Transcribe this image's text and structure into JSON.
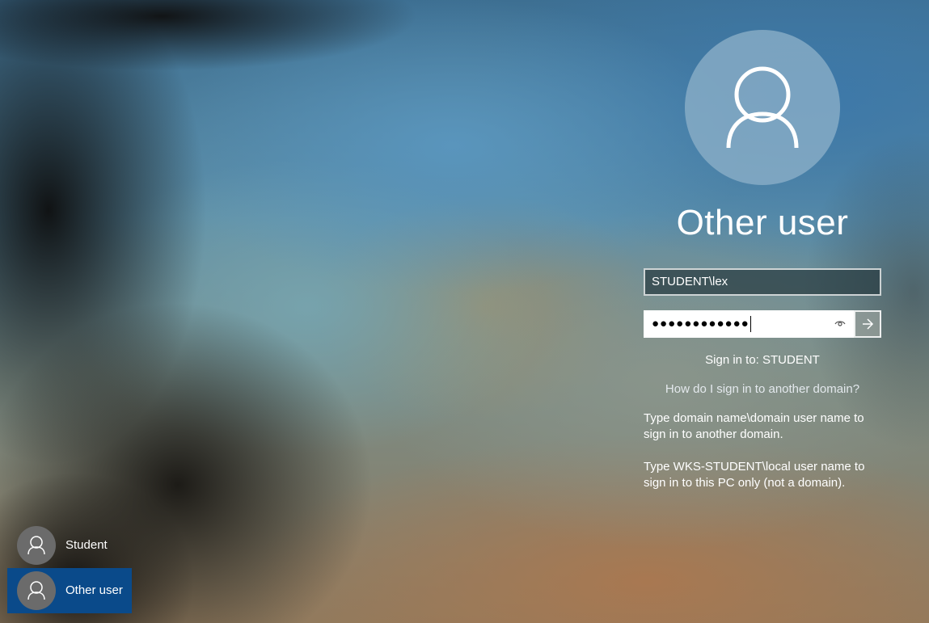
{
  "login": {
    "avatar_icon": "user-icon",
    "user_title": "Other user",
    "username_value": "STUDENT\\lex",
    "password_mask": "●●●●●●●●●●●●",
    "reveal_icon": "eye-icon",
    "submit_icon": "arrow-right-icon",
    "sign_in_to": "Sign in to: STUDENT",
    "help_link": "How do I sign in to another domain?",
    "help_text_1": "Type domain name\\domain user name to sign in to another domain.",
    "help_text_2": "Type WKS-STUDENT\\local user name to sign in to this PC only (not a domain)."
  },
  "user_list": {
    "users": [
      {
        "label": "Student",
        "icon": "user-icon",
        "selected": false
      },
      {
        "label": "Other user",
        "icon": "user-icon",
        "selected": true
      }
    ]
  },
  "colors": {
    "selected_tile": "#0a4a8a",
    "avatar_circle": "#8cafc8",
    "tile_avatar": "#6b6b6b"
  }
}
